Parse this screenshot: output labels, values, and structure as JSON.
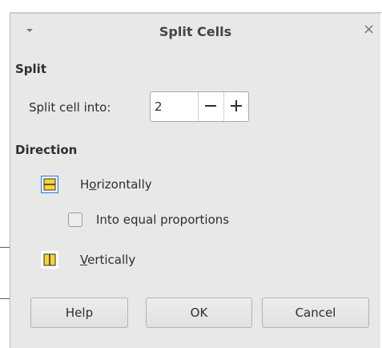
{
  "dialog": {
    "title": "Split Cells",
    "close_glyph": "×",
    "menu_icon": "triangle-down-icon"
  },
  "split": {
    "section_title": "Split",
    "split_into_label": "Split cell into:",
    "split_into_value": "2",
    "minus_glyph": "−",
    "plus_glyph": "+"
  },
  "direction": {
    "section_title": "Direction",
    "horizontal": {
      "label_pre": "H",
      "label_mnemonic": "o",
      "label_post": "rizontally",
      "selected": true,
      "icon": "split-horizontal-icon"
    },
    "equal_proportions": {
      "label": "Into equal proportions",
      "checked": false
    },
    "vertical": {
      "label_mnemonic": "V",
      "label_post": "ertically",
      "selected": false,
      "icon": "split-vertical-icon"
    }
  },
  "buttons": {
    "help": "Help",
    "ok": "OK",
    "cancel": "Cancel"
  },
  "colors": {
    "dialog_bg": "#e8e8e7",
    "accent_blue": "#3c86d9",
    "icon_yellow": "#f7d532"
  }
}
